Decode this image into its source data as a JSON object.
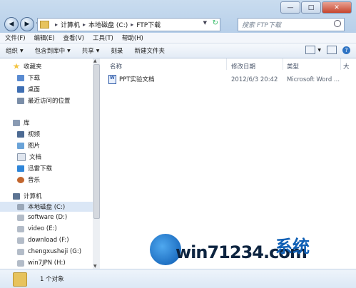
{
  "window": {
    "controls": [
      "—",
      "□",
      "✕"
    ]
  },
  "address": {
    "crumbs": [
      "计算机",
      "本地磁盘 (C:)",
      "FTP下载"
    ]
  },
  "search": {
    "placeholder": "搜索 FTP下载"
  },
  "menu": [
    "文件(F)",
    "编辑(E)",
    "查看(V)",
    "工具(T)",
    "帮助(H)"
  ],
  "toolbar": {
    "organize": "组织",
    "include": "包含到库中",
    "share": "共享",
    "burn": "刻录",
    "new_folder": "新建文件夹"
  },
  "nav": {
    "favorites": {
      "label": "收藏夹",
      "items": [
        "下载",
        "桌面",
        "最近访问的位置"
      ]
    },
    "libraries": {
      "label": "库",
      "items": [
        "视频",
        "图片",
        "文档",
        "迅雷下载",
        "音乐"
      ]
    },
    "computer": {
      "label": "计算机",
      "items": [
        "本地磁盘 (C:)",
        "software (D:)",
        "video (E:)",
        "download (F:)",
        "chengxusheji (G:)",
        "win7JPN (H:)"
      ]
    }
  },
  "columns": [
    "名称",
    "修改日期",
    "类型",
    "大"
  ],
  "files": [
    {
      "name": "PPT实验文档",
      "date": "2012/6/3 20:42",
      "type": "Microsoft Word ..."
    }
  ],
  "status": {
    "text": "1 个对象"
  },
  "watermark": {
    "domain": "win71234.com",
    "brand": "系统"
  },
  "colors": {
    "accent": "#2f74c4",
    "folder": "#e7c35d",
    "selected": "#dbe7f6"
  }
}
